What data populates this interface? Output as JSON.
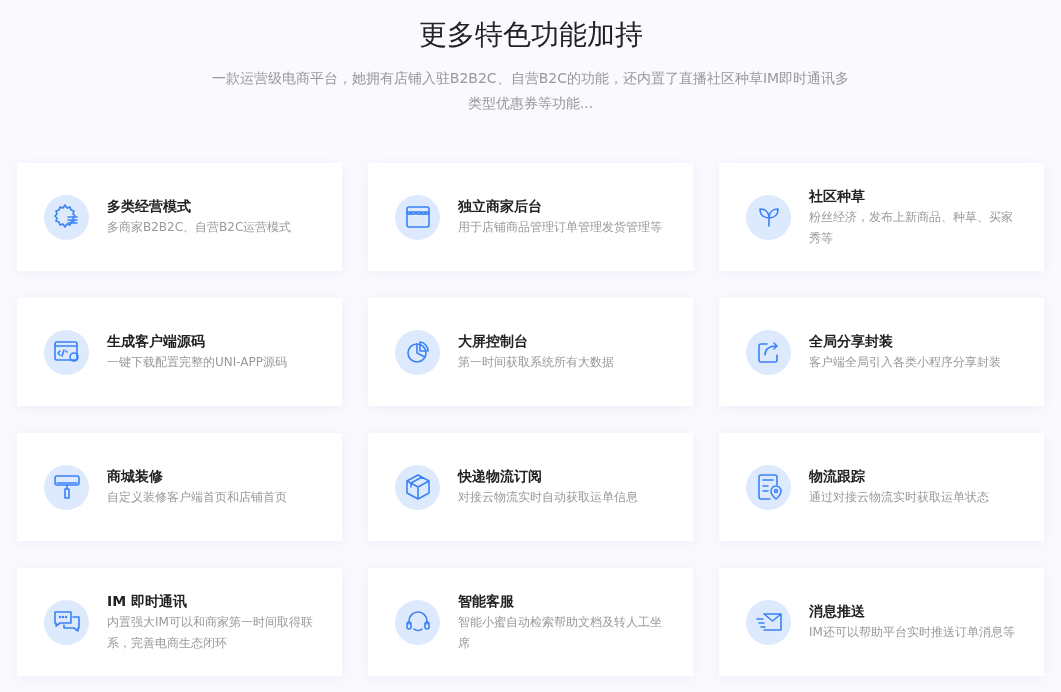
{
  "heading": "更多特色功能加持",
  "intro": "一款运营级电商平台，她拥有店铺入驻B2B2C、自营B2C的功能，还内置了直播社区种草IM即时通讯多类型优惠券等功能...",
  "features": [
    {
      "title": "多类经营模式",
      "description": "多商家B2B2C、自营B2C运营模式"
    },
    {
      "title": "独立商家后台",
      "description": "用于店铺商品管理订单管理发货管理等"
    },
    {
      "title": "社区种草",
      "description": "粉丝经济，发布上新商品、种草、买家秀等"
    },
    {
      "title": "生成客户端源码",
      "description": "一键下载配置完整的UNI-APP源码"
    },
    {
      "title": "大屏控制台",
      "description": "第一时间获取系统所有大数据"
    },
    {
      "title": "全局分享封装",
      "description": "客户端全局引入各类小程序分享封装"
    },
    {
      "title": "商城装修",
      "description": "自定义装修客户端首页和店铺首页"
    },
    {
      "title": "快递物流订阅",
      "description": "对接云物流实时自动获取运单信息"
    },
    {
      "title": "物流跟踪",
      "description": "通过对接云物流实时获取运单状态"
    },
    {
      "title": "IM 即时通讯",
      "description": "内置强大IM可以和商家第一时间取得联系，完善电商生态闭环"
    },
    {
      "title": "智能客服",
      "description": "智能小蜜自动检索帮助文档及转人工坐席"
    },
    {
      "title": "消息推送",
      "description": "IM还可以帮助平台实时推送订单消息等"
    }
  ]
}
